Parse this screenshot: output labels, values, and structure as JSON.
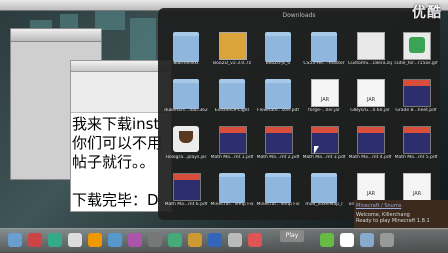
{
  "watermark": "优酷",
  "stack": {
    "title": "Downloads",
    "items": [
      {
        "label": "BlarredText",
        "kind": "folder"
      },
      {
        "label": "Boo2D_v2.3.0.7z",
        "kind": "archive7z"
      },
      {
        "label": "boo2d-js_0",
        "kind": "folder"
      },
      {
        "label": "CS53-He...-master",
        "kind": "folder"
      },
      {
        "label": "CustomS...18era.zip",
        "kind": "archive"
      },
      {
        "label": "cutie_for...r15os.gif",
        "kind": "app"
      },
      {
        "label": "dukehars...3acr3e2",
        "kind": "folder"
      },
      {
        "label": "Existence-Light",
        "kind": "folder"
      },
      {
        "label": "FlowRate...ster.pdf",
        "kind": "folder"
      },
      {
        "label": "forge-...ller.jar",
        "kind": "jar"
      },
      {
        "label": "GIBys/G...0.60.jar",
        "kind": "jar"
      },
      {
        "label": "Grade 8...heet.pdf",
        "kind": "pdf"
      },
      {
        "label": "Hologra...plays.jar",
        "kind": "cup"
      },
      {
        "label": "Math Ma...mt 1.pdf",
        "kind": "pdf"
      },
      {
        "label": "Math Ma...mt 2.pdf",
        "kind": "pdf"
      },
      {
        "label": "Math Ma...mt 3.pdf",
        "kind": "pdf"
      },
      {
        "label": "Math Ma...mt 4.pdf",
        "kind": "pdf"
      },
      {
        "label": "Math Ma...mt 5.pdf",
        "kind": "pdf"
      },
      {
        "label": "Math Ma...mt 6.pdf",
        "kind": "pdf"
      },
      {
        "label": "Minecraf...Temp Fix",
        "kind": "folder"
      },
      {
        "label": "Minecraf...Temp Fix",
        "kind": "folder"
      },
      {
        "label": "mod_voxelMap_I",
        "kind": "folder"
      },
      {
        "label": "original-...utsen.jar",
        "kind": "jar"
      },
      {
        "label": "ProtocolLib.jar",
        "kind": "jar"
      }
    ]
  },
  "document": {
    "lines": [
      "我来下载inst",
      "你们可以不用",
      "帖子就行。。",
      "",
      "下载完毕：D"
    ]
  },
  "launcher": {
    "links": "Minecraft / Snums",
    "line1": "Welcome, Killerchang",
    "line2": "Ready to play Minecraft 1.8.1"
  },
  "dock": {
    "play_label": "Play"
  }
}
